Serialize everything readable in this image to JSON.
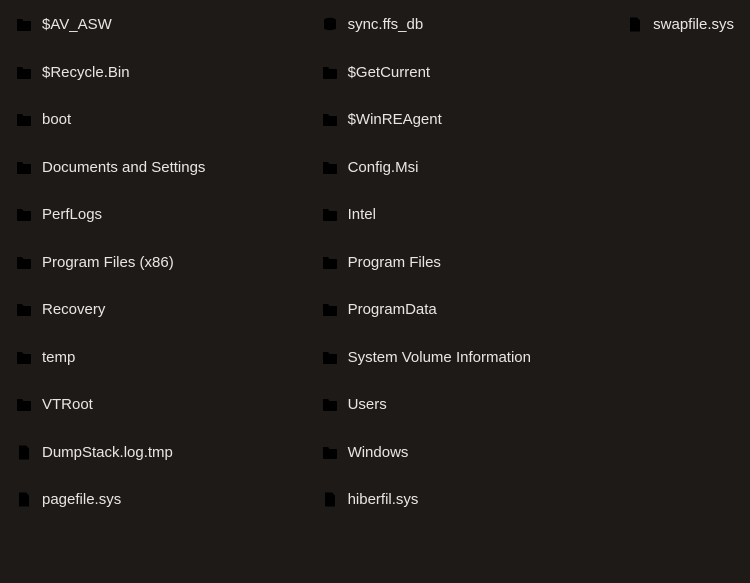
{
  "items": [
    {
      "name": "$AV_ASW",
      "icon": "folder-dim"
    },
    {
      "name": "$Recycle.Bin",
      "icon": "folder-dim"
    },
    {
      "name": "boot",
      "icon": "folder-bright"
    },
    {
      "name": "Documents and Settings",
      "icon": "folder-dim"
    },
    {
      "name": "PerfLogs",
      "icon": "folder-bright"
    },
    {
      "name": "Program Files (x86)",
      "icon": "folder-bright"
    },
    {
      "name": "Recovery",
      "icon": "folder-dim"
    },
    {
      "name": "temp",
      "icon": "folder-bright"
    },
    {
      "name": "VTRoot",
      "icon": "folder-dim"
    },
    {
      "name": "DumpStack.log.tmp",
      "icon": "file"
    },
    {
      "name": "pagefile.sys",
      "icon": "file"
    },
    {
      "name": "sync.ffs_db",
      "icon": "db"
    },
    {
      "name": "$GetCurrent",
      "icon": "folder-dim"
    },
    {
      "name": "$WinREAgent",
      "icon": "folder-dim"
    },
    {
      "name": "Config.Msi",
      "icon": "folder-dim"
    },
    {
      "name": "Intel",
      "icon": "folder-bright"
    },
    {
      "name": "Program Files",
      "icon": "folder-bright"
    },
    {
      "name": "ProgramData",
      "icon": "folder-dim"
    },
    {
      "name": "System Volume Information",
      "icon": "folder-dim"
    },
    {
      "name": "Users",
      "icon": "folder-bright"
    },
    {
      "name": "Windows",
      "icon": "folder-bright"
    },
    {
      "name": "hiberfil.sys",
      "icon": "file"
    },
    {
      "name": "swapfile.sys",
      "icon": "file"
    }
  ]
}
